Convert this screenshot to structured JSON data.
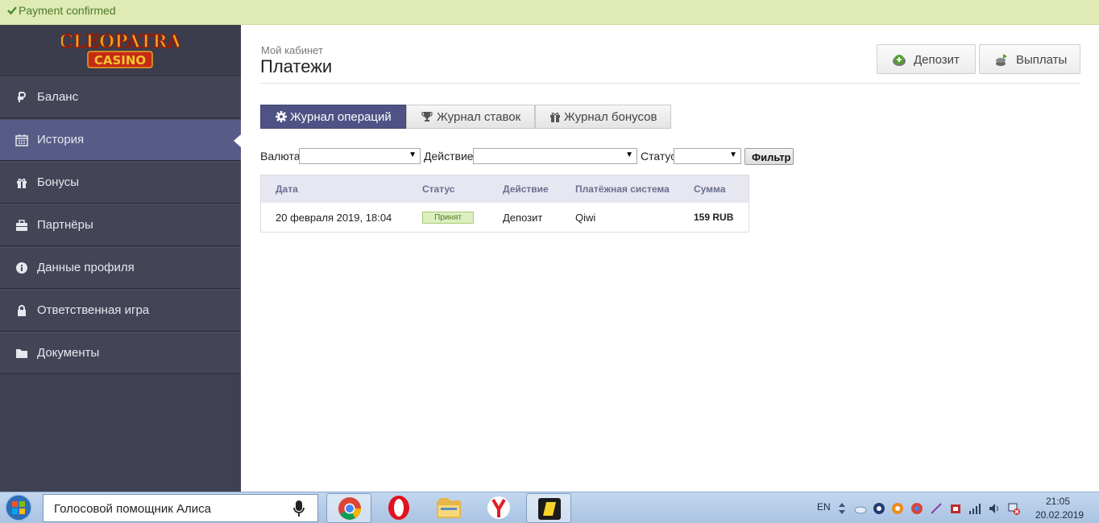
{
  "notice": {
    "message": "Payment confirmed",
    "icon": "check-icon",
    "color": "#4a7a2a"
  },
  "brand": {
    "logo_line1": "CLEOPATRA",
    "logo_line2": "CASINO"
  },
  "sidebar": {
    "items": [
      {
        "label": "Баланс",
        "icon": "ruble-icon",
        "active": false
      },
      {
        "label": "История",
        "icon": "calendar-icon",
        "active": true
      },
      {
        "label": "Бонусы",
        "icon": "gift-icon",
        "active": false
      },
      {
        "label": "Партнёры",
        "icon": "briefcase-icon",
        "active": false
      },
      {
        "label": "Данные профиля",
        "icon": "info-icon",
        "active": false
      },
      {
        "label": "Ответственная игра",
        "icon": "lock-icon",
        "active": false
      },
      {
        "label": "Документы",
        "icon": "folder-icon",
        "active": false
      }
    ]
  },
  "header": {
    "breadcrumb": "Мой кабинет",
    "title": "Платежи",
    "deposit_label": "Депозит",
    "payouts_label": "Выплаты"
  },
  "tabs": [
    {
      "label": "Журнал операций",
      "icon": "gear-icon",
      "active": true
    },
    {
      "label": "Журнал ставок",
      "icon": "trophy-icon",
      "active": false
    },
    {
      "label": "Журнал бонусов",
      "icon": "gift-icon",
      "active": false
    }
  ],
  "filters": {
    "currency_label": "Валюта",
    "currency_value": "",
    "action_label": "Действие",
    "action_value": "",
    "status_label": "Статус",
    "status_value": "",
    "filter_button": "Фильтр"
  },
  "table": {
    "columns": [
      "Дата",
      "Статус",
      "Действие",
      "Платёжная система",
      "Сумма"
    ],
    "rows": [
      {
        "date": "20 февраля 2019, 18:04",
        "status": "Принят",
        "action": "Депозит",
        "system": "Qiwi",
        "amount": "159 RUB"
      }
    ]
  },
  "taskbar": {
    "search_text": "Голосовой помощник Алиса",
    "apps": [
      "chrome-icon",
      "opera-icon",
      "explorer-icon",
      "yandex-browser-icon",
      "sticky-app-icon"
    ],
    "language": "EN",
    "time": "21:05",
    "date": "20.02.2019"
  },
  "colors": {
    "accent": "#4e5284",
    "sidebar_bg": "#3f4152",
    "sidebar_active": "#575c86",
    "notice_bg": "#dfeab4",
    "badge_bg": "#dcefc1"
  }
}
